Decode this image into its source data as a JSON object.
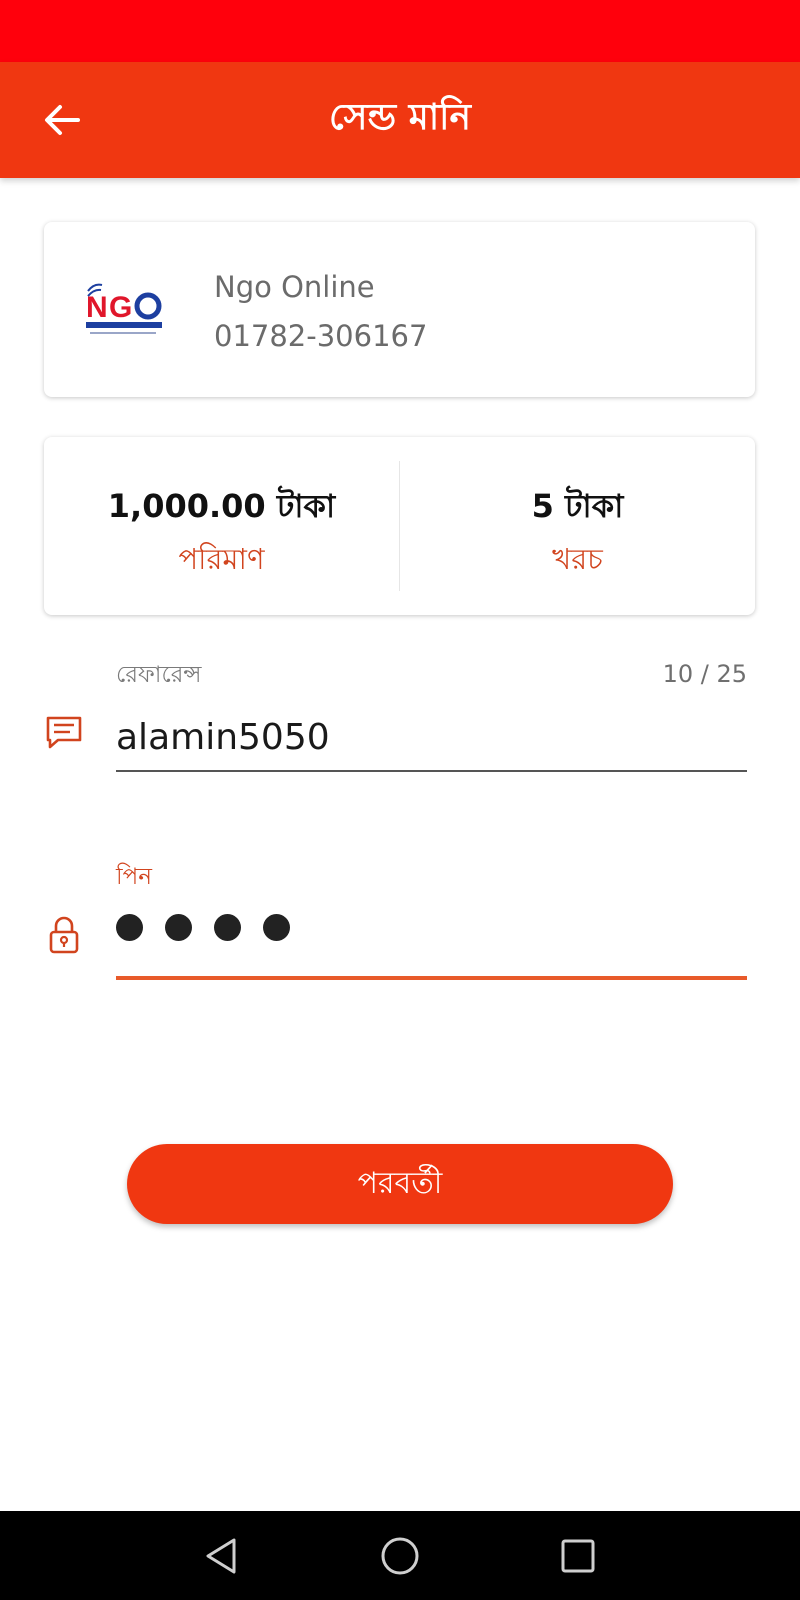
{
  "header": {
    "title": "সেন্ড মানি",
    "back_icon": "arrow-left-icon"
  },
  "recipient": {
    "name": "Ngo Online",
    "phone": "01782-306167",
    "logo_text": "NGO",
    "logo_subtext": "NEW GENERATION ONLINE"
  },
  "amount": {
    "value": "1,000.00 টাকা",
    "label": "পরিমাণ"
  },
  "charge": {
    "value": "5 টাকা",
    "label": "খরচ"
  },
  "reference": {
    "label": "রেফারেন্স",
    "value": "alamin5050",
    "counter": "10 / 25",
    "icon": "message-icon"
  },
  "pin": {
    "label": "পিন",
    "masked_length": 4,
    "icon": "lock-icon"
  },
  "next_button": {
    "label": "পরবর্তী"
  },
  "system_nav": {
    "back_icon": "nav-back-icon",
    "home_icon": "nav-home-icon",
    "recent_icon": "nav-recent-icon"
  },
  "colors": {
    "status_bar": "#ff000c",
    "primary": "#f03711",
    "accent_text": "#d1441e",
    "pin_underline": "#e85a2a"
  }
}
